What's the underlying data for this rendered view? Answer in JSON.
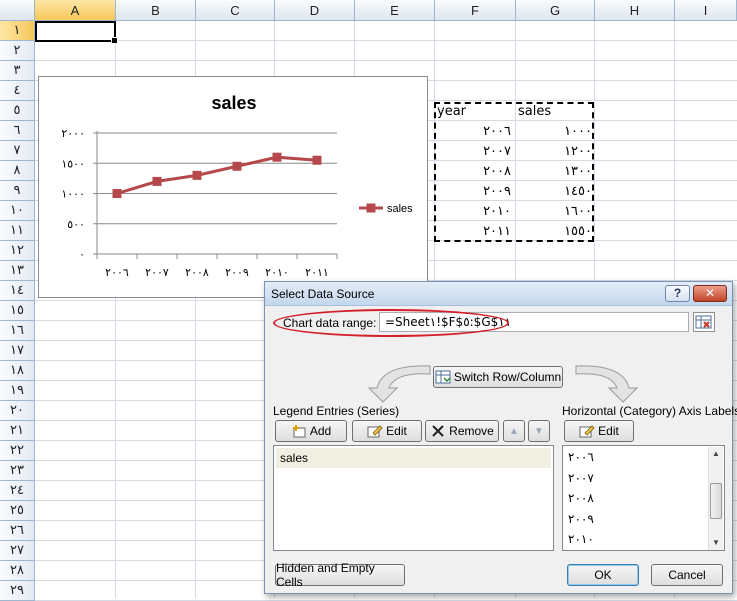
{
  "spreadsheet": {
    "columns": [
      "A",
      "B",
      "C",
      "D",
      "E",
      "F",
      "G",
      "H",
      "I"
    ],
    "rows": [
      "١",
      "٢",
      "٣",
      "٤",
      "٥",
      "٦",
      "٧",
      "٨",
      "٩",
      "١٠",
      "١١",
      "١٢",
      "١٣",
      "١٤",
      "١٥",
      "١٦",
      "١٧",
      "١٨",
      "١٩",
      "٢٠",
      "٢١",
      "٢٢",
      "٢٣",
      "٢٤",
      "٢٥",
      "٢٦",
      "٢٧",
      "٢٨",
      "٢٩"
    ],
    "table": {
      "header_year": "year",
      "header_sales": "sales",
      "years": [
        "٢٠٠٦",
        "٢٠٠٧",
        "٢٠٠٨",
        "٢٠٠٩",
        "٢٠١٠",
        "٢٠١١"
      ],
      "sales": [
        "١٠٠٠",
        "١٢٠٠",
        "١٣٠٠",
        "١٤٥٠",
        "١٦٠٠",
        "١٥٥٠"
      ]
    }
  },
  "chart_data": {
    "type": "line",
    "title": "sales",
    "categories": [
      "٢٠٠٦",
      "٢٠٠٧",
      "٢٠٠٨",
      "٢٠٠٩",
      "٢٠١٠",
      "٢٠١١"
    ],
    "series": [
      {
        "name": "sales",
        "values": [
          1000,
          1200,
          1300,
          1450,
          1600,
          1550
        ],
        "color": "#b5484a"
      }
    ],
    "ylim": [
      0,
      2000
    ],
    "yticks": [
      0,
      500,
      1000,
      1500,
      2000
    ],
    "ytick_labels": [
      "٠",
      "٥٠٠",
      "١٠٠٠",
      "١٥٠٠",
      "٢٠٠٠"
    ],
    "grid": true,
    "legend": "right"
  },
  "dialog": {
    "title": "Select Data Source",
    "help_label": "?",
    "close_label": "✕",
    "range_label": "Chart data range:",
    "range_value": "=Sheet١!$F$٥:$G$١١",
    "switch_label": "Switch Row/Column",
    "legend_header": "Legend Entries (Series)",
    "axis_header": "Horizontal (Category) Axis Labels",
    "add_label": "Add",
    "edit_label": "Edit",
    "remove_label": "Remove",
    "axis_edit_label": "Edit",
    "series_items": [
      "sales"
    ],
    "category_items": [
      "٢٠٠٦",
      "٢٠٠٧",
      "٢٠٠٨",
      "٢٠٠٩",
      "٢٠١٠"
    ],
    "hidden_cells_label": "Hidden and Empty Cells",
    "ok_label": "OK",
    "cancel_label": "Cancel",
    "highlight_color": "#d21f2a"
  }
}
